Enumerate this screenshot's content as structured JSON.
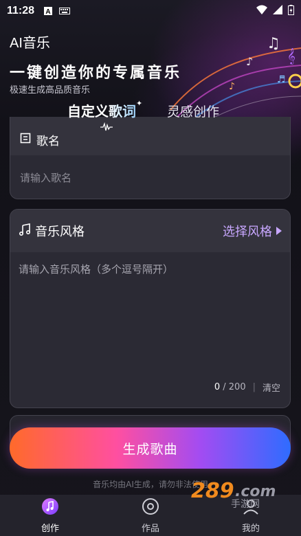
{
  "status_bar": {
    "time": "11:28"
  },
  "header": {
    "app_title": "AI音乐",
    "headline": "一键创造你的专属音乐",
    "subline": "极速生成高品质音乐"
  },
  "tabs": {
    "active_prefix": "自定义",
    "active_highlight": "歌词",
    "inactive": "灵感创作"
  },
  "song_name": {
    "label": "歌名",
    "placeholder": "请输入歌名"
  },
  "music_style": {
    "label": "音乐风格",
    "pick_label": "选择风格",
    "placeholder": "请输入音乐风格（多个逗号隔开）",
    "count_current": "0",
    "count_max": "/ 200",
    "clear_label": "清空"
  },
  "generate_button": {
    "label": "生成歌曲"
  },
  "disclaimer": "音乐均由AI生成，请勿非法使用",
  "bottom_nav": [
    {
      "label": "创作",
      "icon": "music-disc-icon",
      "active": true
    },
    {
      "label": "作品",
      "icon": "disc-icon",
      "active": false
    },
    {
      "label": "我的",
      "icon": "user-icon",
      "active": false
    }
  ],
  "watermark": {
    "brand": "289.com",
    "site": "手游网"
  },
  "colors": {
    "accent_purple": "#c8a7ff",
    "button_gradient": [
      "#ff6a2a",
      "#ff4fa0",
      "#a24cf2",
      "#2f6cff"
    ]
  }
}
